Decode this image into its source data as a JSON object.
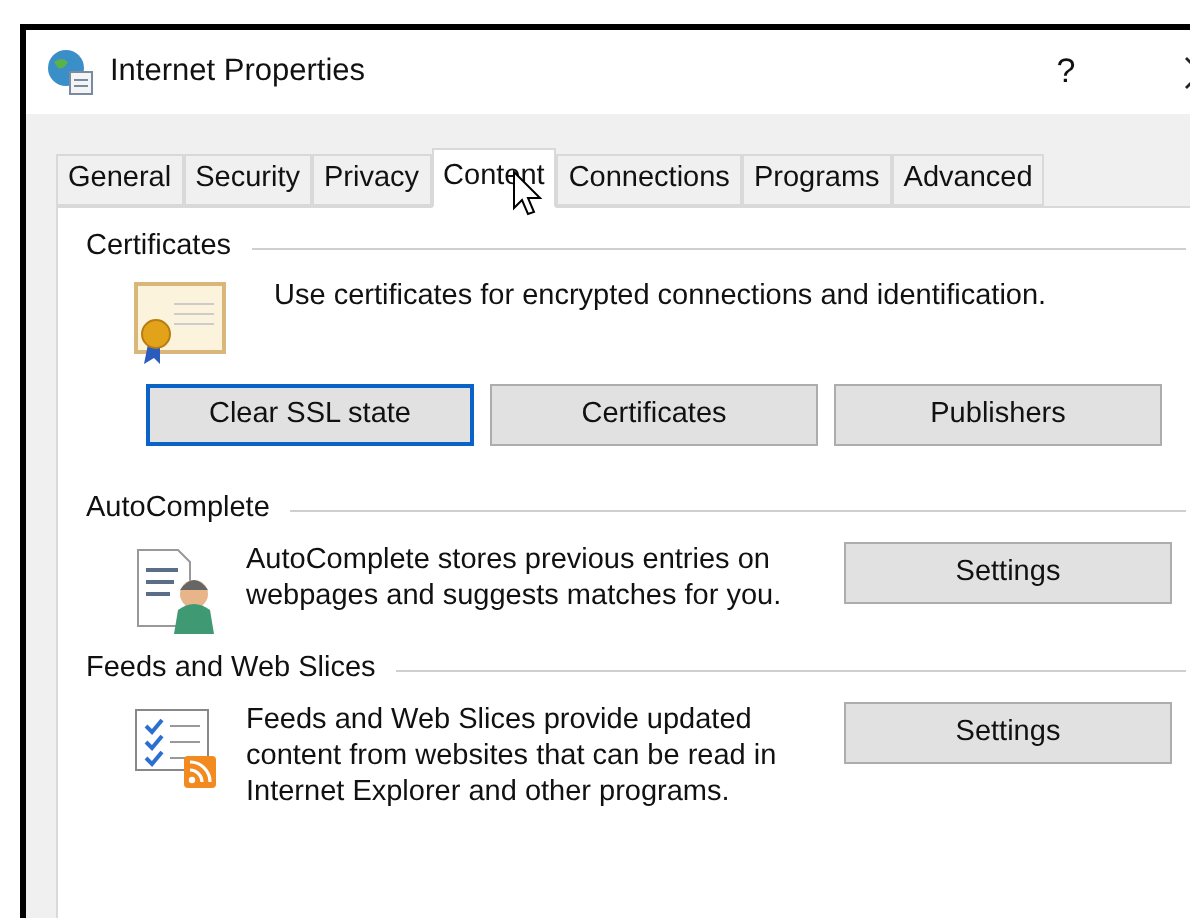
{
  "window": {
    "title": "Internet Properties",
    "help": "?"
  },
  "tabs": [
    {
      "label": "General",
      "selected": false
    },
    {
      "label": "Security",
      "selected": false
    },
    {
      "label": "Privacy",
      "selected": false
    },
    {
      "label": "Content",
      "selected": true
    },
    {
      "label": "Connections",
      "selected": false
    },
    {
      "label": "Programs",
      "selected": false
    },
    {
      "label": "Advanced",
      "selected": false
    }
  ],
  "sections": [
    {
      "kind": "certificates",
      "title": "Certificates",
      "text": "Use certificates for encrypted connections and identification.",
      "buttons": [
        {
          "label": "Clear SSL state",
          "focused": true
        },
        {
          "label": "Certificates",
          "focused": false
        },
        {
          "label": "Publishers",
          "focused": false
        }
      ]
    },
    {
      "kind": "autocomplete",
      "title": "AutoComplete",
      "text": "AutoComplete stores previous entries on webpages and suggests matches for you.",
      "buttons": [
        {
          "label": "Settings",
          "focused": false
        }
      ]
    },
    {
      "kind": "feeds",
      "title": "Feeds and Web Slices",
      "text": "Feeds and Web Slices provide updated content from websites that can be read in Internet Explorer and other programs.",
      "buttons": [
        {
          "label": "Settings",
          "focused": false
        }
      ]
    }
  ]
}
